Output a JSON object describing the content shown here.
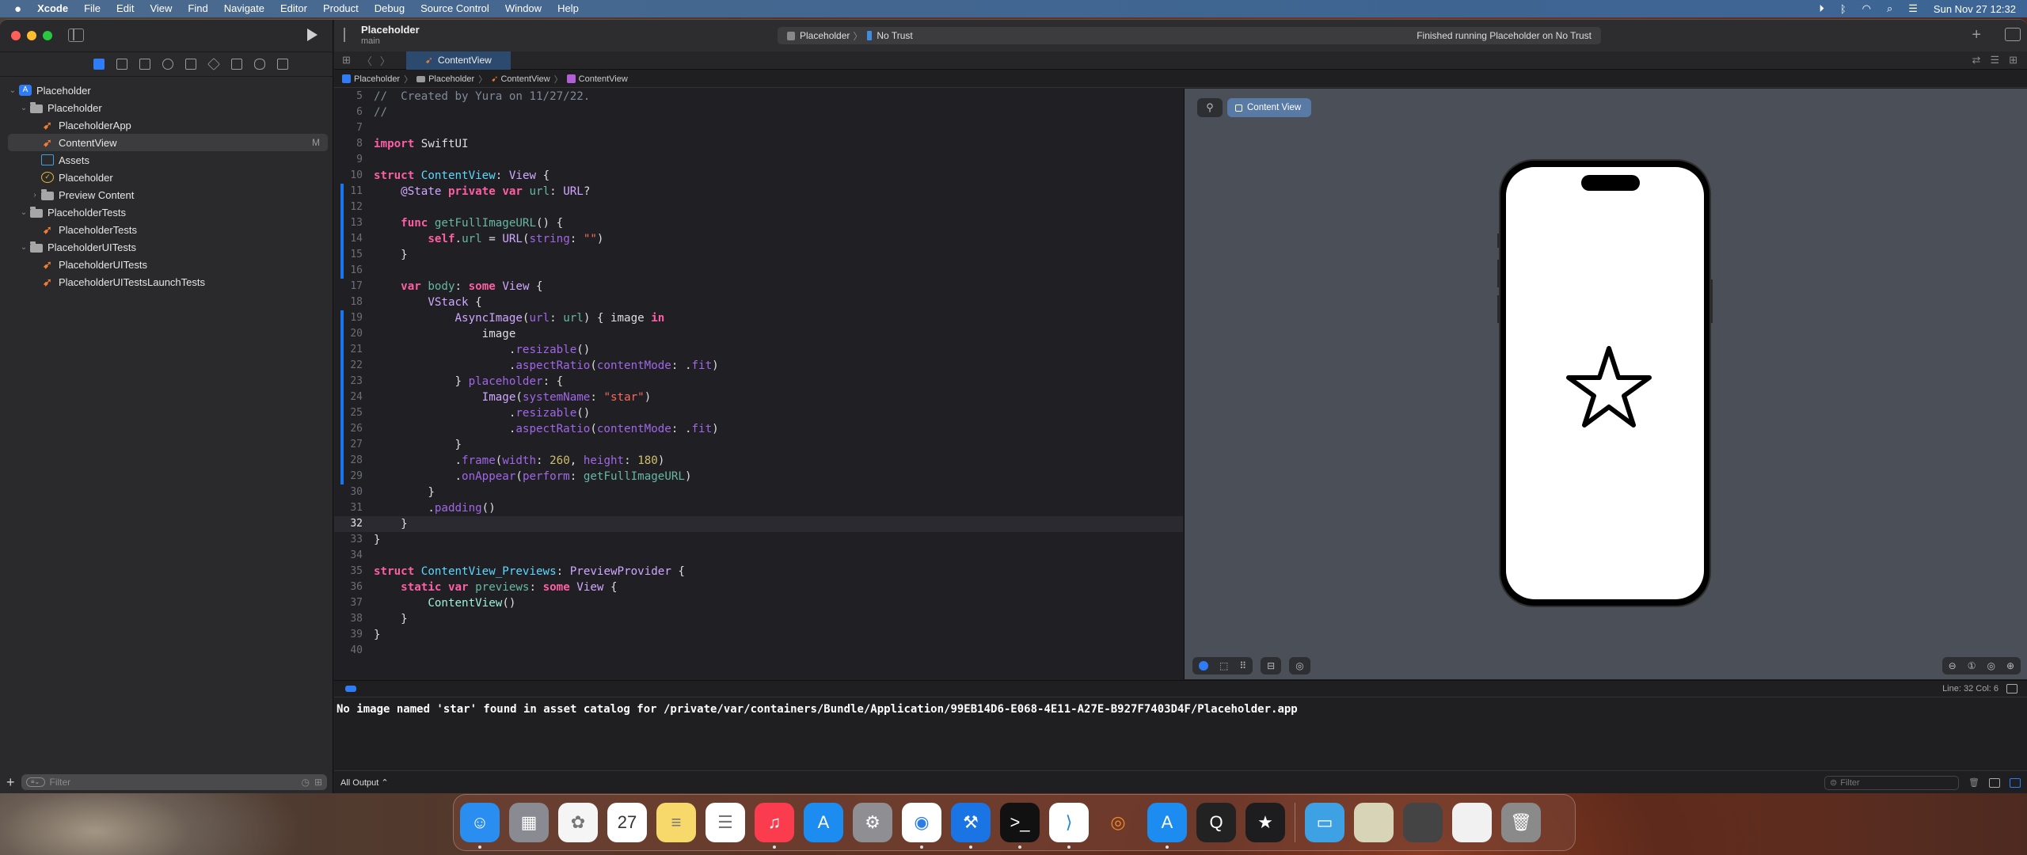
{
  "menubar": {
    "app_name": "Xcode",
    "items": [
      "File",
      "Edit",
      "View",
      "Find",
      "Navigate",
      "Editor",
      "Product",
      "Debug",
      "Source Control",
      "Window",
      "Help"
    ],
    "status_icons": [
      "screen-record-icon",
      "bluetooth-icon",
      "wifi-icon",
      "spotlight-icon",
      "control-center-icon"
    ],
    "clock": "Sun Nov 27  12:32"
  },
  "toolbar": {
    "project_title": "Placeholder",
    "branch": "main",
    "scheme": "Placeholder",
    "destination": "No Trust",
    "status": "Finished running Placeholder on No Trust"
  },
  "navigator": {
    "tree": [
      {
        "label": "Placeholder",
        "icon": "project-icon",
        "depth": 0,
        "expanded": true
      },
      {
        "label": "Placeholder",
        "icon": "folder-icon",
        "depth": 1,
        "expanded": true
      },
      {
        "label": "PlaceholderApp",
        "icon": "swift-file-icon",
        "depth": 2
      },
      {
        "label": "ContentView",
        "icon": "swift-file-icon",
        "depth": 2,
        "selected": true,
        "badge": "M"
      },
      {
        "label": "Assets",
        "icon": "asset-catalog-icon",
        "depth": 2
      },
      {
        "label": "Placeholder",
        "icon": "entitlements-icon",
        "depth": 2
      },
      {
        "label": "Preview Content",
        "icon": "folder-icon",
        "depth": 2,
        "expanded": false
      },
      {
        "label": "PlaceholderTests",
        "icon": "folder-icon",
        "depth": 1,
        "expanded": true
      },
      {
        "label": "PlaceholderTests",
        "icon": "swift-file-icon",
        "depth": 2
      },
      {
        "label": "PlaceholderUITests",
        "icon": "folder-icon",
        "depth": 1,
        "expanded": true
      },
      {
        "label": "PlaceholderUITests",
        "icon": "swift-file-icon",
        "depth": 2
      },
      {
        "label": "PlaceholderUITestsLaunchTests",
        "icon": "swift-file-icon",
        "depth": 2
      }
    ],
    "filter_placeholder": "Filter"
  },
  "editor": {
    "tab": "ContentView",
    "jumpbar": [
      "Placeholder",
      "Placeholder",
      "ContentView",
      "ContentView"
    ],
    "current_line": 32,
    "lines": [
      {
        "n": 5,
        "tokens": [
          [
            "cm",
            "//  Created by Yura on 11/27/22."
          ]
        ]
      },
      {
        "n": 6,
        "tokens": [
          [
            "cm",
            "//"
          ]
        ]
      },
      {
        "n": 7,
        "tokens": []
      },
      {
        "n": 8,
        "tokens": [
          [
            "kw",
            "import"
          ],
          [
            "plain",
            " SwiftUI"
          ]
        ]
      },
      {
        "n": 9,
        "tokens": []
      },
      {
        "n": 10,
        "tokens": [
          [
            "kw",
            "struct"
          ],
          [
            "plain",
            " "
          ],
          [
            "decl",
            "ContentView"
          ],
          [
            "plain",
            ": "
          ],
          [
            "type",
            "View"
          ],
          [
            "plain",
            " {"
          ]
        ]
      },
      {
        "n": 11,
        "chg": true,
        "tokens": [
          [
            "plain",
            "    "
          ],
          [
            "type",
            "@State"
          ],
          [
            "plain",
            " "
          ],
          [
            "kw",
            "private"
          ],
          [
            "plain",
            " "
          ],
          [
            "kw",
            "var"
          ],
          [
            "plain",
            " "
          ],
          [
            "id",
            "url"
          ],
          [
            "plain",
            ": "
          ],
          [
            "type",
            "URL"
          ],
          [
            "plain",
            "?"
          ]
        ]
      },
      {
        "n": 12,
        "chg": true,
        "tokens": []
      },
      {
        "n": 13,
        "chg": true,
        "tokens": [
          [
            "plain",
            "    "
          ],
          [
            "kw",
            "func"
          ],
          [
            "plain",
            " "
          ],
          [
            "id",
            "getFullImageURL"
          ],
          [
            "plain",
            "() {"
          ]
        ]
      },
      {
        "n": 14,
        "chg": true,
        "tokens": [
          [
            "plain",
            "        "
          ],
          [
            "self",
            "self"
          ],
          [
            "plain",
            "."
          ],
          [
            "id",
            "url"
          ],
          [
            "plain",
            " = "
          ],
          [
            "type",
            "URL"
          ],
          [
            "plain",
            "("
          ],
          [
            "fn",
            "string"
          ],
          [
            "plain",
            ": "
          ],
          [
            "str",
            "\"\""
          ],
          [
            "plain",
            ")"
          ]
        ]
      },
      {
        "n": 15,
        "chg": true,
        "tokens": [
          [
            "plain",
            "    }"
          ]
        ]
      },
      {
        "n": 16,
        "chg": true,
        "tokens": []
      },
      {
        "n": 17,
        "tokens": [
          [
            "plain",
            "    "
          ],
          [
            "kw",
            "var"
          ],
          [
            "plain",
            " "
          ],
          [
            "id",
            "body"
          ],
          [
            "plain",
            ": "
          ],
          [
            "kw",
            "some"
          ],
          [
            "plain",
            " "
          ],
          [
            "type",
            "View"
          ],
          [
            "plain",
            " {"
          ]
        ]
      },
      {
        "n": 18,
        "tokens": [
          [
            "plain",
            "        "
          ],
          [
            "type",
            "VStack"
          ],
          [
            "plain",
            " {"
          ]
        ]
      },
      {
        "n": 19,
        "chg": true,
        "tokens": [
          [
            "plain",
            "            "
          ],
          [
            "type",
            "AsyncImage"
          ],
          [
            "plain",
            "("
          ],
          [
            "fn",
            "url"
          ],
          [
            "plain",
            ": "
          ],
          [
            "id",
            "url"
          ],
          [
            "plain",
            ") { image "
          ],
          [
            "kw",
            "in"
          ]
        ]
      },
      {
        "n": 20,
        "chg": true,
        "tokens": [
          [
            "plain",
            "                image"
          ]
        ]
      },
      {
        "n": 21,
        "chg": true,
        "tokens": [
          [
            "plain",
            "                    ."
          ],
          [
            "fn",
            "resizable"
          ],
          [
            "plain",
            "()"
          ]
        ]
      },
      {
        "n": 22,
        "chg": true,
        "tokens": [
          [
            "plain",
            "                    ."
          ],
          [
            "fn",
            "aspectRatio"
          ],
          [
            "plain",
            "("
          ],
          [
            "fn",
            "contentMode"
          ],
          [
            "plain",
            ": ."
          ],
          [
            "fn",
            "fit"
          ],
          [
            "plain",
            ")"
          ]
        ]
      },
      {
        "n": 23,
        "chg": true,
        "tokens": [
          [
            "plain",
            "            } "
          ],
          [
            "fn",
            "placeholder"
          ],
          [
            "plain",
            ": {"
          ]
        ]
      },
      {
        "n": 24,
        "chg": true,
        "tokens": [
          [
            "plain",
            "                "
          ],
          [
            "type",
            "Image"
          ],
          [
            "plain",
            "("
          ],
          [
            "fn",
            "systemName"
          ],
          [
            "plain",
            ": "
          ],
          [
            "str",
            "\"star\""
          ],
          [
            "plain",
            ")"
          ]
        ]
      },
      {
        "n": 25,
        "chg": true,
        "tokens": [
          [
            "plain",
            "                    ."
          ],
          [
            "fn",
            "resizable"
          ],
          [
            "plain",
            "()"
          ]
        ]
      },
      {
        "n": 26,
        "chg": true,
        "tokens": [
          [
            "plain",
            "                    ."
          ],
          [
            "fn",
            "aspectRatio"
          ],
          [
            "plain",
            "("
          ],
          [
            "fn",
            "contentMode"
          ],
          [
            "plain",
            ": ."
          ],
          [
            "fn",
            "fit"
          ],
          [
            "plain",
            ")"
          ]
        ]
      },
      {
        "n": 27,
        "chg": true,
        "tokens": [
          [
            "plain",
            "            }"
          ]
        ]
      },
      {
        "n": 28,
        "chg": true,
        "tokens": [
          [
            "plain",
            "            ."
          ],
          [
            "fn",
            "frame"
          ],
          [
            "plain",
            "("
          ],
          [
            "fn",
            "width"
          ],
          [
            "plain",
            ": "
          ],
          [
            "num",
            "260"
          ],
          [
            "plain",
            ", "
          ],
          [
            "fn",
            "height"
          ],
          [
            "plain",
            ": "
          ],
          [
            "num",
            "180"
          ],
          [
            "plain",
            ")"
          ]
        ]
      },
      {
        "n": 29,
        "chg": true,
        "tokens": [
          [
            "plain",
            "            ."
          ],
          [
            "fn",
            "onAppear"
          ],
          [
            "plain",
            "("
          ],
          [
            "fn",
            "perform"
          ],
          [
            "plain",
            ": "
          ],
          [
            "id",
            "getFullImageURL"
          ],
          [
            "plain",
            ")"
          ]
        ]
      },
      {
        "n": 30,
        "tokens": [
          [
            "plain",
            "        }"
          ]
        ]
      },
      {
        "n": 31,
        "tokens": [
          [
            "plain",
            "        ."
          ],
          [
            "fn",
            "padding"
          ],
          [
            "plain",
            "()"
          ]
        ]
      },
      {
        "n": 32,
        "tokens": [
          [
            "plain",
            "    }"
          ]
        ]
      },
      {
        "n": 33,
        "tokens": [
          [
            "plain",
            "}"
          ]
        ]
      },
      {
        "n": 34,
        "tokens": []
      },
      {
        "n": 35,
        "tokens": [
          [
            "kw",
            "struct"
          ],
          [
            "plain",
            " "
          ],
          [
            "decl",
            "ContentView_Previews"
          ],
          [
            "plain",
            ": "
          ],
          [
            "type",
            "PreviewProvider"
          ],
          [
            "plain",
            " {"
          ]
        ]
      },
      {
        "n": 36,
        "tokens": [
          [
            "plain",
            "    "
          ],
          [
            "kw",
            "static"
          ],
          [
            "plain",
            " "
          ],
          [
            "kw",
            "var"
          ],
          [
            "plain",
            " "
          ],
          [
            "id",
            "previews"
          ],
          [
            "plain",
            ": "
          ],
          [
            "kw",
            "some"
          ],
          [
            "plain",
            " "
          ],
          [
            "type",
            "View"
          ],
          [
            "plain",
            " {"
          ]
        ]
      },
      {
        "n": 37,
        "tokens": [
          [
            "plain",
            "        "
          ],
          [
            "prj",
            "ContentView"
          ],
          [
            "plain",
            "()"
          ]
        ]
      },
      {
        "n": 38,
        "tokens": [
          [
            "plain",
            "    }"
          ]
        ]
      },
      {
        "n": 39,
        "tokens": [
          [
            "plain",
            "}"
          ]
        ]
      },
      {
        "n": 40,
        "tokens": []
      }
    ]
  },
  "canvas": {
    "preview_label": "Content View",
    "preview_symbol": "star-icon"
  },
  "debug": {
    "line_col": "Line: 32  Col: 6",
    "console_output": "No image named 'star' found in asset catalog for /private/var/containers/Bundle/Application/99EB14D6-E068-4E11-A27E-B927F7403D4F/Placeholder.app",
    "output_selector": "All Output ⌃",
    "filter_placeholder": "Filter"
  },
  "dock": {
    "apps": [
      {
        "name": "Finder",
        "icon": "finder-icon",
        "color": "#2a8df0",
        "glyph": "☺",
        "running": true
      },
      {
        "name": "Launchpad",
        "icon": "launchpad-icon",
        "color": "#8a8a92",
        "glyph": "▦",
        "running": false
      },
      {
        "name": "Photos",
        "icon": "photos-icon",
        "color": "#f5f5f5",
        "glyph": "✿",
        "running": false
      },
      {
        "name": "Calendar",
        "icon": "calendar-icon",
        "color": "#ffffff",
        "glyph": "27",
        "running": false
      },
      {
        "name": "Notes",
        "icon": "notes-icon",
        "color": "#f7d86a",
        "glyph": "≡",
        "running": false
      },
      {
        "name": "Reminders",
        "icon": "reminders-icon",
        "color": "#ffffff",
        "glyph": "☰",
        "running": false
      },
      {
        "name": "Music",
        "icon": "music-icon",
        "color": "#fb3c4e",
        "glyph": "♫",
        "running": true
      },
      {
        "name": "App Store",
        "icon": "app-store-icon",
        "color": "#1c8cf0",
        "glyph": "A",
        "running": false
      },
      {
        "name": "System Settings",
        "icon": "system-settings-icon",
        "color": "#8e8e93",
        "glyph": "⚙",
        "running": false
      },
      {
        "name": "Chrome",
        "icon": "chrome-icon",
        "color": "#ffffff",
        "glyph": "◉",
        "running": true
      },
      {
        "name": "Xcode",
        "icon": "xcode-icon",
        "color": "#1b74e4",
        "glyph": "⚒",
        "running": true
      },
      {
        "name": "Terminal",
        "icon": "terminal-icon",
        "color": "#111111",
        "glyph": ">_",
        "running": true
      },
      {
        "name": "VS Code",
        "icon": "vscode-icon",
        "color": "#ffffff",
        "glyph": "⟩",
        "running": true
      },
      {
        "name": "Blender",
        "icon": "blender-icon",
        "color": "transparent",
        "glyph": "◎",
        "running": false
      },
      {
        "name": "Simulator",
        "icon": "simulator-icon",
        "color": "#1c8cf0",
        "glyph": "A",
        "running": true
      },
      {
        "name": "QuickTime",
        "icon": "quicktime-icon",
        "color": "#222222",
        "glyph": "Q",
        "running": false
      },
      {
        "name": "Beta App",
        "icon": "beta-app-icon",
        "color": "#1d1d1f",
        "glyph": "★",
        "running": false
      }
    ],
    "stacks": [
      {
        "name": "Folder",
        "icon": "folder-stack-icon",
        "color": "#3ea1e4",
        "glyph": "▭"
      },
      {
        "name": "Window 1",
        "icon": "window-thumbnail-icon",
        "color": "#d8d4b8",
        "glyph": ""
      },
      {
        "name": "Window 2",
        "icon": "chrome-window-thumbnail-icon",
        "color": "#444",
        "glyph": ""
      },
      {
        "name": "Window 3",
        "icon": "chrome-window-thumbnail-icon",
        "color": "#f1f1f1",
        "glyph": ""
      },
      {
        "name": "Trash",
        "icon": "trash-icon",
        "color": "#8a8a8a",
        "glyph": "🗑"
      }
    ]
  }
}
